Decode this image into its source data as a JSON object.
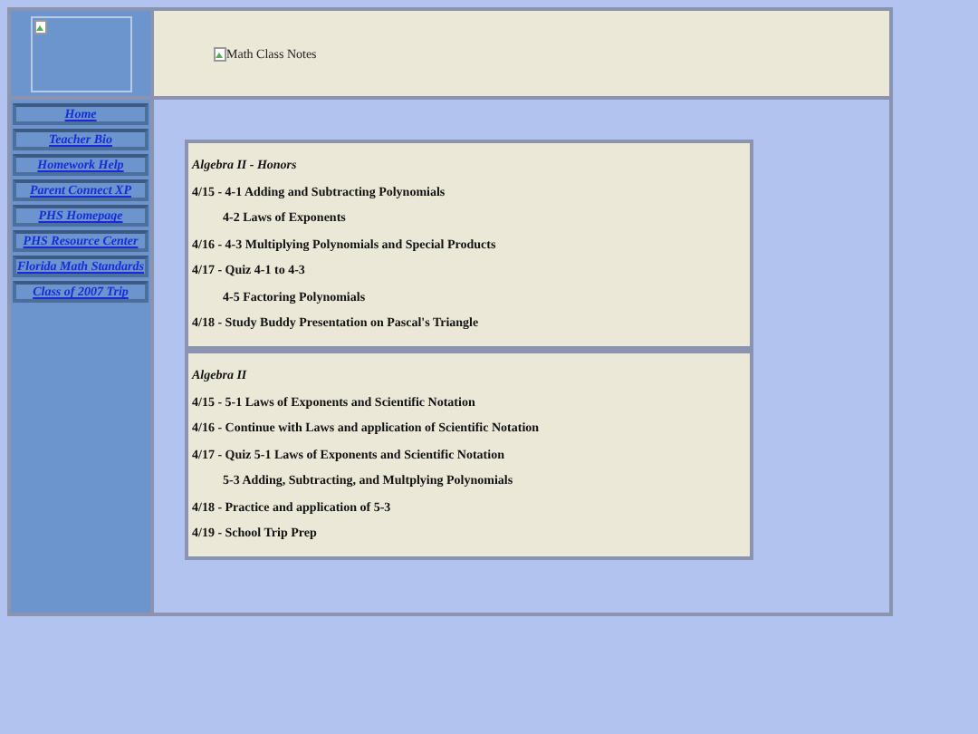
{
  "header": {
    "banner_alt": "Math Class Notes"
  },
  "nav": [
    {
      "label": "Home"
    },
    {
      "label": "Teacher Bio"
    },
    {
      "label": "Homework Help"
    },
    {
      "label": "Parent Connect XP"
    },
    {
      "label": "PHS Homepage"
    },
    {
      "label": "PHS Resource Center"
    },
    {
      "label": "Florida Math Standards"
    },
    {
      "label": "Class of 2007 Trip"
    }
  ],
  "sections": [
    {
      "title": "Algebra II - Honors",
      "entries": [
        {
          "text": "4/15 - 4-1 Adding and Subtracting Polynomials",
          "indented": false
        },
        {
          "text": "4-2 Laws of Exponents",
          "indented": true
        },
        {
          "text": "4/16 - 4-3 Multiplying Polynomials and Special Products",
          "indented": false
        },
        {
          "text": "4/17 - Quiz 4-1 to 4-3",
          "indented": false
        },
        {
          "text": "4-5 Factoring Polynomials",
          "indented": true
        },
        {
          "text": "4/18 - Study Buddy Presentation on Pascal's Triangle",
          "indented": false
        }
      ]
    },
    {
      "title": "Algebra II",
      "entries": [
        {
          "text": "4/15 - 5-1 Laws of Exponents and Scientific Notation",
          "indented": false
        },
        {
          "text": "4/16 - Continue with Laws and application of Scientific Notation",
          "indented": false
        },
        {
          "text": "4/17 - Quiz 5-1 Laws of Exponents and Scientific Notation",
          "indented": false
        },
        {
          "text": "5-3 Adding, Subtracting, and Multplying Polynomials",
          "indented": true
        },
        {
          "text": "4/18 - Practice and application of 5-3",
          "indented": false
        },
        {
          "text": "4/19 - School Trip Prep",
          "indented": false
        }
      ]
    }
  ]
}
